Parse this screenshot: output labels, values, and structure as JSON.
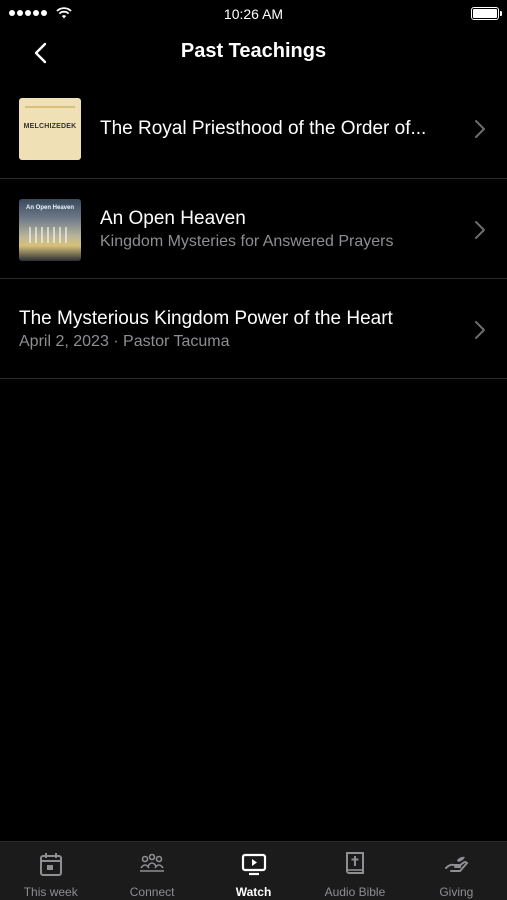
{
  "status_bar": {
    "time": "10:26 AM"
  },
  "nav": {
    "title": "Past Teachings"
  },
  "items": [
    {
      "title": "The Royal Priesthood of the Order of...",
      "thumbnail_text": "MELCHIZEDEK"
    },
    {
      "title": "An Open Heaven",
      "subtitle": "Kingdom Mysteries for Answered Prayers",
      "thumbnail_text": "An Open Heaven"
    },
    {
      "title": "The Mysterious Kingdom Power of the Heart",
      "subtitle": "April 2, 2023 · Pastor Tacuma"
    }
  ],
  "tabs": [
    {
      "label": "This week",
      "icon": "calendar-icon",
      "active": false
    },
    {
      "label": "Connect",
      "icon": "people-icon",
      "active": false
    },
    {
      "label": "Watch",
      "icon": "tv-icon",
      "active": true
    },
    {
      "label": "Audio Bible",
      "icon": "bible-icon",
      "active": false
    },
    {
      "label": "Giving",
      "icon": "giving-hand-icon",
      "active": false
    }
  ],
  "colors": {
    "background": "#000000",
    "tabbar": "#1b1b1c",
    "secondary_text": "#8e8e93",
    "divider": "#2a2a2a"
  }
}
